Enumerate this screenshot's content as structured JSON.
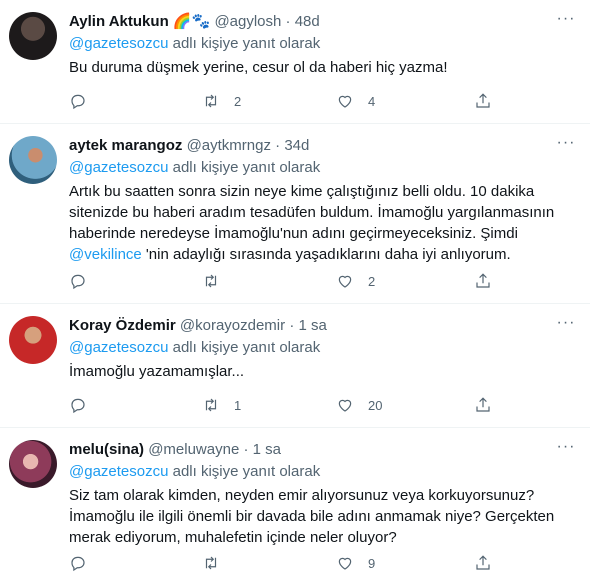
{
  "ui": {
    "reply_prefix": "@gazetesozcu",
    "reply_suffix": " adlı kişiye yanıt olarak",
    "dot": "·",
    "more": "···"
  },
  "colors": {
    "link": "#1d9bf0",
    "muted": "#536471",
    "text": "#0f1419",
    "divider": "#eff3f4"
  },
  "tweets": [
    {
      "name": "Aylin Aktukun",
      "emoji": "🌈🐾",
      "handle": "@agylosh",
      "time": "48d",
      "text": "Bu duruma düşmek yerine, cesur ol da haberi hiç yazma!",
      "replies": "",
      "retweets": "2",
      "likes": "4"
    },
    {
      "name": "aytek marangoz",
      "handle": "@aytkmrngz",
      "time": "34d",
      "text_before": "Artık bu saatten sonra sizin neye kime çalıştığınız belli oldu. 10 dakika sitenizde bu haberi aradım tesadüfen buldum. İmamoğlu yargılanmasının haberinde neredeyse İmamoğlu'nun adını geçirmeyeceksiniz. Şimdi ",
      "mention": "@vekilince",
      "text_after": "  'nin adaylığı sırasında yaşadıklarını daha iyi anlıyorum.",
      "replies": "",
      "retweets": "",
      "likes": "2"
    },
    {
      "name": "Koray Özdemir",
      "handle": "@korayozdemir",
      "time": "1 sa",
      "text": "İmamoğlu yazamamışlar...",
      "replies": "",
      "retweets": "1",
      "likes": "20"
    },
    {
      "name": "melu(sina)",
      "handle": "@meluwayne",
      "time": "1 sa",
      "text": "Siz tam olarak kimden, neyden emir alıyorsunuz veya korkuyorsunuz? İmamoğlu ile ilgili önemli bir davada bile adını anmamak niye? Gerçekten merak ediyorum, muhalefetin içinde neler oluyor?",
      "replies": "",
      "retweets": "",
      "likes": "9"
    }
  ]
}
